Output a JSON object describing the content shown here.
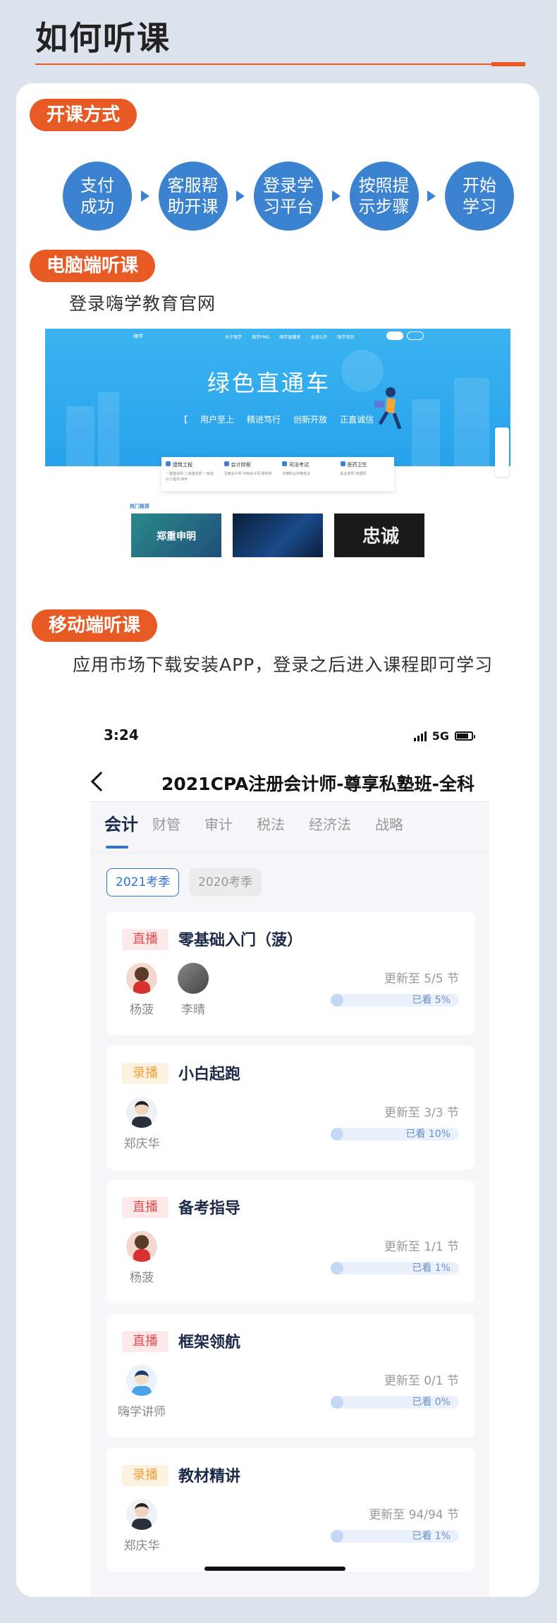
{
  "header": {
    "title": "如何听课"
  },
  "sections": {
    "open_course": {
      "label": "开课方式"
    },
    "pc": {
      "label": "电脑端听课",
      "desc": "登录嗨学教育官网"
    },
    "mobile": {
      "label": "移动端听课",
      "desc": "应用市场下载安装APP，登录之后进入课程即可学习"
    }
  },
  "steps": [
    {
      "line1": "支付",
      "line2": "成功"
    },
    {
      "line1": "客服帮",
      "line2": "助开课"
    },
    {
      "line1": "登录学",
      "line2": "习平台"
    },
    {
      "line1": "按照提",
      "line2": "示步骤"
    },
    {
      "line1": "开始",
      "line2": "学习"
    }
  ],
  "website": {
    "logo": "嗨学",
    "nav": [
      "关于嗨学",
      "嗨学FMG",
      "嗨学直播室",
      "全部公开",
      "嗨学资讯"
    ],
    "hero_title": "绿色直通车",
    "slogans": [
      "【",
      "用户至上",
      "精进笃行",
      "创新开放",
      "正直诚信"
    ],
    "categories": [
      {
        "name": "建筑工程",
        "sub": "一建建造师 二级建造师 一级造价工程师 BIM"
      },
      {
        "name": "会计财税",
        "sub": "注册会计师 中级会计师 税务师"
      },
      {
        "name": "司法考试",
        "sub": "法律职业资格考试"
      },
      {
        "name": "医药卫生",
        "sub": "执业药师 管理师"
      }
    ],
    "hot_label": "热门推荐",
    "thumb1_text": "郑重申明",
    "thumb3_text": "忠诚"
  },
  "phone": {
    "status": {
      "time": "3:24",
      "network": "5G"
    },
    "title": "2021CPA注册会计师-尊享私塾班-全科",
    "tabs": [
      "会计",
      "财管",
      "审计",
      "税法",
      "经济法",
      "战略"
    ],
    "seasons": [
      "2021考季",
      "2020考季"
    ],
    "courses": [
      {
        "tag": "直播",
        "type": "live",
        "title": "零基础入门（菠）",
        "teachers": [
          "杨菠",
          "李晴"
        ],
        "update": "更新至 5/5 节",
        "progress_label": "已看 5%",
        "progress": 0.05
      },
      {
        "tag": "录播",
        "type": "rec",
        "title": "小白起跑",
        "teachers": [
          "郑庆华"
        ],
        "update": "更新至 3/3 节",
        "progress_label": "已看 10%",
        "progress": 0.1
      },
      {
        "tag": "直播",
        "type": "live",
        "title": "备考指导",
        "teachers": [
          "杨菠"
        ],
        "update": "更新至 1/1 节",
        "progress_label": "已看 1%",
        "progress": 0.01
      },
      {
        "tag": "直播",
        "type": "live",
        "title": "框架领航",
        "teachers": [
          "嗨学讲师"
        ],
        "update": "更新至 0/1 节",
        "progress_label": "已看 0%",
        "progress": 0.0
      },
      {
        "tag": "录播",
        "type": "rec",
        "title": "教材精讲",
        "teachers": [
          "郑庆华"
        ],
        "update": "更新至 94/94 节",
        "progress_label": "已看 1%",
        "progress": 0.01
      }
    ]
  },
  "colors": {
    "accent": "#e85a24",
    "step_blue": "#3b82d0",
    "tab_blue": "#2e72d6"
  }
}
